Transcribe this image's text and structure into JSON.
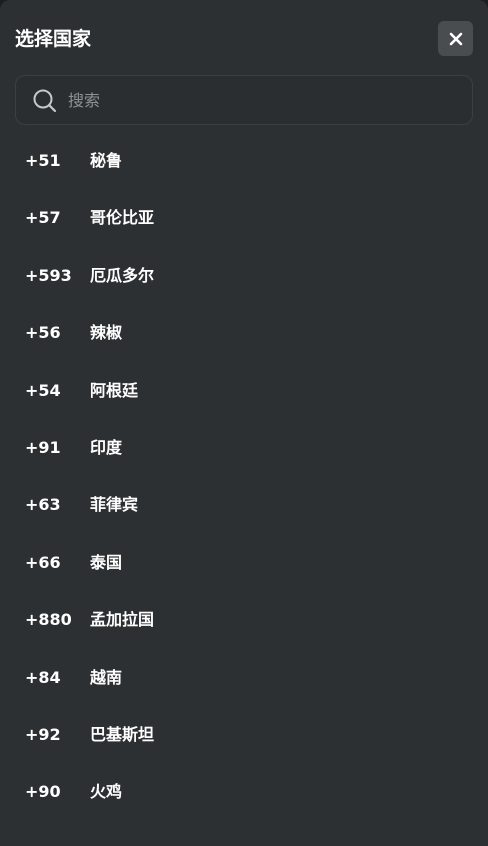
{
  "header": {
    "title": "选择国家",
    "close_icon": "close-icon"
  },
  "search": {
    "placeholder": "搜索",
    "value": "",
    "icon": "search-icon"
  },
  "countries": [
    {
      "code": "+51",
      "name": "秘鲁"
    },
    {
      "code": "+57",
      "name": "哥伦比亚"
    },
    {
      "code": "+593",
      "name": "厄瓜多尔"
    },
    {
      "code": "+56",
      "name": "辣椒"
    },
    {
      "code": "+54",
      "name": "阿根廷"
    },
    {
      "code": "+91",
      "name": "印度"
    },
    {
      "code": "+63",
      "name": "菲律宾"
    },
    {
      "code": "+66",
      "name": "泰国"
    },
    {
      "code": "+880",
      "name": "孟加拉国"
    },
    {
      "code": "+84",
      "name": "越南"
    },
    {
      "code": "+92",
      "name": "巴基斯坦"
    },
    {
      "code": "+90",
      "name": "火鸡"
    }
  ],
  "colors": {
    "background": "#2d3032",
    "close_button": "#4a4d50",
    "text": "#ffffff",
    "placeholder": "#8d9194"
  }
}
